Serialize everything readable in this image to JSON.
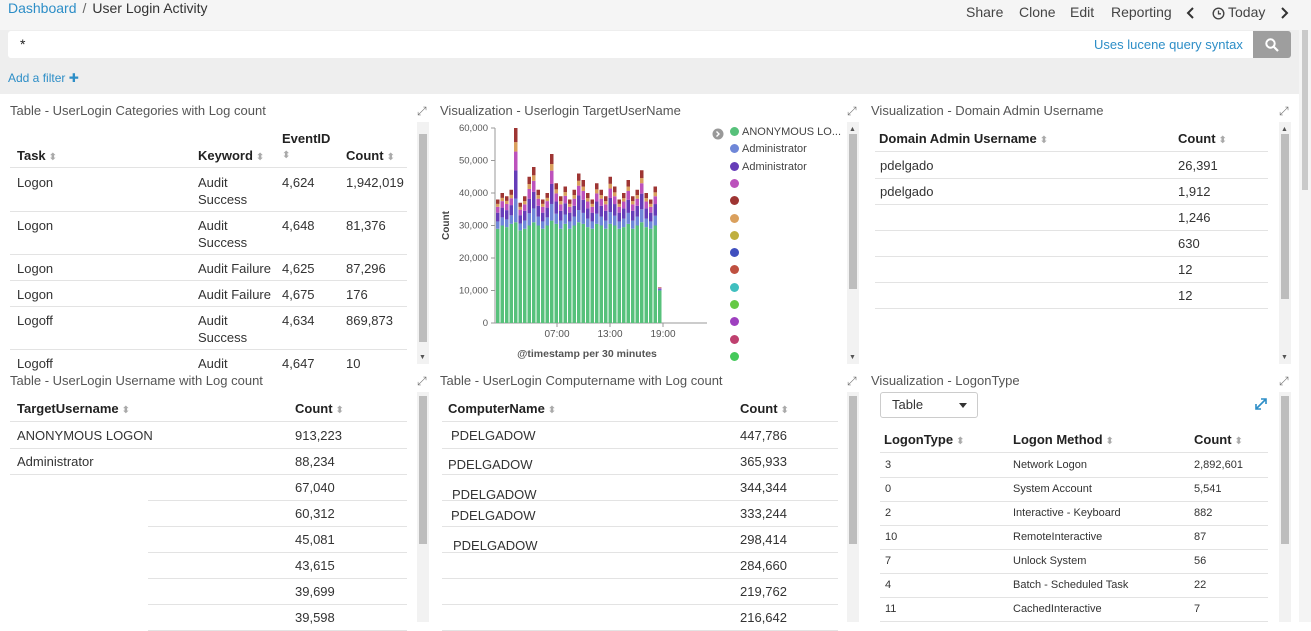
{
  "breadcrumb": {
    "root": "Dashboard",
    "separator": "/",
    "current": "User Login Activity"
  },
  "nav": {
    "share": "Share",
    "clone": "Clone",
    "edit": "Edit",
    "reporting": "Reporting",
    "time": "Today"
  },
  "query": {
    "value": "*",
    "hint": "Uses lucene query syntax"
  },
  "filter": {
    "add_label": "Add a filter"
  },
  "panel1": {
    "title": "Table - UserLogin Categories with Log count",
    "headers": {
      "task": "Task",
      "keyword": "Keyword",
      "eventid": "EventID",
      "count": "Count"
    },
    "rows": [
      {
        "task": "Logon",
        "kw1": "Audit",
        "kw2": "Success",
        "eventid": "4,624",
        "count": "1,942,019"
      },
      {
        "task": "Logon",
        "kw1": "Audit",
        "kw2": "Success",
        "eventid": "4,648",
        "count": "81,376"
      },
      {
        "task": "Logon",
        "kw1": "Audit Failure",
        "kw2": "",
        "eventid": "4,625",
        "count": "87,296"
      },
      {
        "task": "Logon",
        "kw1": "Audit Failure",
        "kw2": "",
        "eventid": "4,675",
        "count": "176"
      },
      {
        "task": "Logoff",
        "kw1": "Audit",
        "kw2": "Success",
        "eventid": "4,634",
        "count": "869,873"
      },
      {
        "task": "Logoff",
        "kw1": "Audit",
        "kw2": "",
        "eventid": "4,647",
        "count": "10"
      }
    ]
  },
  "panel2": {
    "title": "Visualization - Userlogin TargetUserName",
    "legend": [
      {
        "label": "ANONYMOUS LO...",
        "color": "#57c17b"
      },
      {
        "label": "Administrator",
        "color": "#6f87d8"
      },
      {
        "label": "Administrator",
        "color": "#663db8"
      },
      {
        "label": "",
        "color": "#bc52bc"
      },
      {
        "label": "",
        "color": "#9e3533"
      },
      {
        "label": "",
        "color": "#daa05d"
      },
      {
        "label": "",
        "color": "#bfaf40"
      },
      {
        "label": "",
        "color": "#4050bf"
      },
      {
        "label": "",
        "color": "#bf5040"
      },
      {
        "label": "",
        "color": "#40bfbf"
      },
      {
        "label": "",
        "color": "#66c945"
      },
      {
        "label": "",
        "color": "#9e40bf"
      },
      {
        "label": "",
        "color": "#bf406f"
      },
      {
        "label": "",
        "color": "#45c95b"
      }
    ],
    "chart_data": {
      "type": "bar",
      "stacked": true,
      "xlabel": "@timestamp per 30 minutes",
      "ylabel": "Count",
      "ylim": [
        0,
        60000
      ],
      "yticks": [
        "0",
        "10,000",
        "20,000",
        "30,000",
        "40,000",
        "50,000",
        "60,000"
      ],
      "xticks": [
        "07:00",
        "13:00",
        "19:00"
      ],
      "totals": [
        38000,
        40000,
        39000,
        41000,
        60000,
        37000,
        39000,
        45000,
        48000,
        41000,
        38000,
        40000,
        52000,
        43000,
        39000,
        42000,
        38000,
        41000,
        46000,
        44000,
        40000,
        38000,
        43000,
        41000,
        39000,
        45000,
        42000,
        38000,
        40000,
        44000,
        39000,
        41000,
        47000,
        40000,
        38000,
        42000,
        11000
      ],
      "base": [
        29000,
        30000,
        29500,
        30500,
        31000,
        28500,
        29000,
        30000,
        31000,
        30000,
        29000,
        30000,
        31500,
        30500,
        29000,
        30500,
        29000,
        30000,
        31000,
        30500,
        29500,
        29000,
        30500,
        30000,
        29000,
        30500,
        30000,
        29000,
        29500,
        30500,
        29000,
        30000,
        31000,
        29500,
        29000,
        30000,
        10000
      ]
    }
  },
  "panel3": {
    "title": "Visualization - Domain Admin Username",
    "headers": {
      "user": "Domain Admin Username",
      "count": "Count"
    },
    "rows": [
      {
        "user": "pdelgado",
        "count": "26,391"
      },
      {
        "user": "pdelgado",
        "count": "1,912"
      },
      {
        "user": "",
        "count": "1,246"
      },
      {
        "user": "",
        "count": "630"
      },
      {
        "user": "",
        "count": "12"
      },
      {
        "user": "",
        "count": "12"
      }
    ]
  },
  "panel4": {
    "title": "Table - UserLogin Username with Log count",
    "headers": {
      "user": "TargetUsername",
      "count": "Count"
    },
    "rows": [
      {
        "user": "ANONYMOUS LOGON",
        "count": "913,223"
      },
      {
        "user": "Administrator",
        "count": "88,234"
      },
      {
        "user": "",
        "count": "67,040"
      },
      {
        "user": "",
        "count": "60,312"
      },
      {
        "user": "",
        "count": "45,081"
      },
      {
        "user": "",
        "count": "43,615"
      },
      {
        "user": "",
        "count": "39,699"
      },
      {
        "user": "",
        "count": "39,598"
      }
    ]
  },
  "panel5": {
    "title": "Table - UserLogin Computername with Log count",
    "headers": {
      "name": "ComputerName",
      "count": "Count"
    },
    "rows": [
      {
        "name": "PDELGADOW",
        "count": "447,786"
      },
      {
        "name": "PDELGADOW",
        "count": "365,933"
      },
      {
        "name": "PDELGADOW",
        "count": "344,344"
      },
      {
        "name": "PDELGADOW",
        "count": "333,244"
      },
      {
        "name": "PDELGADOW",
        "count": "298,414"
      },
      {
        "name": "",
        "count": "284,660"
      },
      {
        "name": "",
        "count": "219,762"
      },
      {
        "name": "",
        "count": "216,642"
      }
    ]
  },
  "panel6": {
    "title": "Visualization - LogonType",
    "select": "Table",
    "headers": {
      "type": "LogonType",
      "method": "Logon Method",
      "count": "Count"
    },
    "rows": [
      {
        "type": "3",
        "method": "Network Logon",
        "count": "2,892,601"
      },
      {
        "type": "0",
        "method": "System Account",
        "count": "5,541"
      },
      {
        "type": "2",
        "method": "Interactive - Keyboard",
        "count": "882"
      },
      {
        "type": "10",
        "method": "RemoteInteractive",
        "count": "87"
      },
      {
        "type": "7",
        "method": "Unlock System",
        "count": "56"
      },
      {
        "type": "4",
        "method": "Batch - Scheduled Task",
        "count": "22"
      },
      {
        "type": "11",
        "method": "CachedInteractive",
        "count": "7"
      }
    ]
  }
}
